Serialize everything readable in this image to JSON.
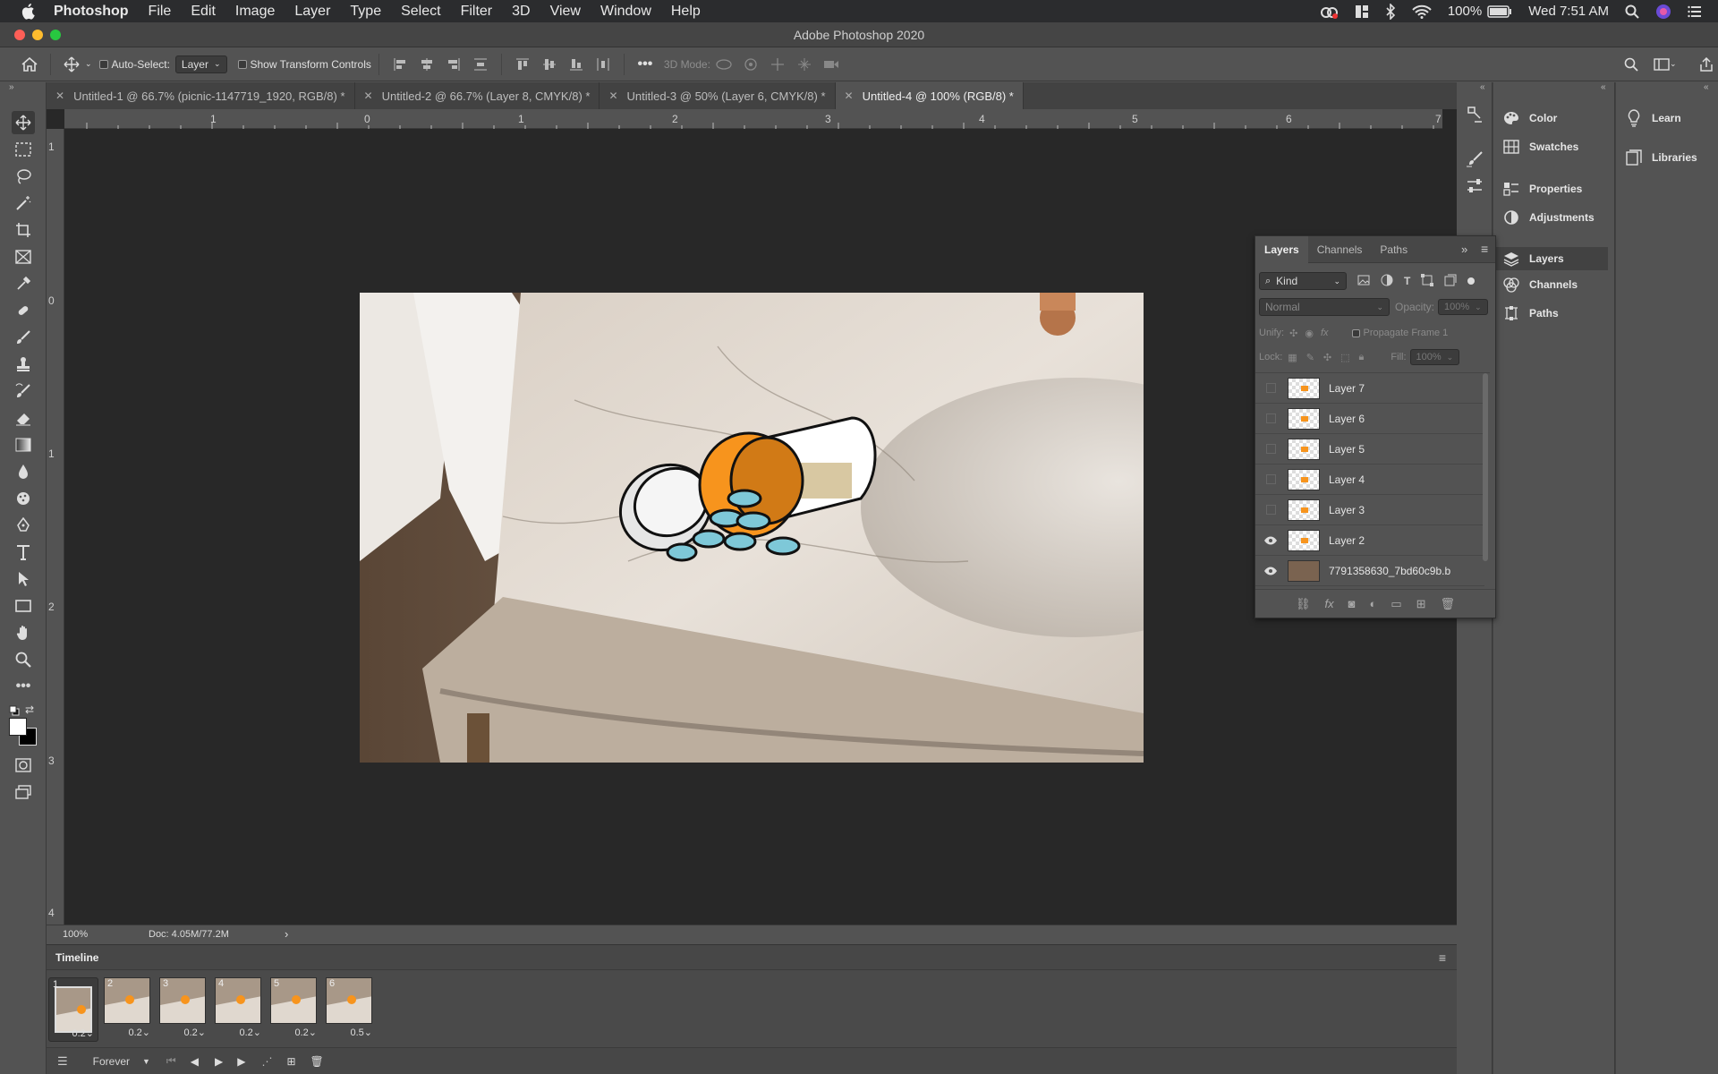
{
  "menubar": {
    "app": "Photoshop",
    "items": [
      "File",
      "Edit",
      "Image",
      "Layer",
      "Type",
      "Select",
      "Filter",
      "3D",
      "View",
      "Window",
      "Help"
    ],
    "battery": "100%",
    "clock": "Wed 7:51 AM"
  },
  "window": {
    "title": "Adobe Photoshop 2020"
  },
  "options": {
    "auto_select_label": "Auto-Select:",
    "auto_select_value": "Layer",
    "show_transform_label": "Show Transform Controls",
    "mode_3d_label": "3D Mode:"
  },
  "tabs": [
    {
      "label": "Untitled-1 @ 66.7% (picnic-1147719_1920, RGB/8) *"
    },
    {
      "label": "Untitled-2 @ 66.7% (Layer 8, CMYK/8) *"
    },
    {
      "label": "Untitled-3 @ 50% (Layer 6, CMYK/8) *"
    },
    {
      "label": "Untitled-4 @ 100% (RGB/8) *"
    }
  ],
  "ruler": {
    "h": [
      "1",
      "0",
      "1",
      "2",
      "3",
      "4",
      "5",
      "6",
      "7"
    ],
    "v": [
      "1",
      "0",
      "1",
      "2",
      "3",
      "4"
    ]
  },
  "status": {
    "zoom": "100%",
    "doc": "Doc: 4.05M/77.2M",
    "arrow": "›"
  },
  "timeline": {
    "title": "Timeline",
    "frames": [
      {
        "num": "1",
        "delay": "0.2"
      },
      {
        "num": "2",
        "delay": "0.2"
      },
      {
        "num": "3",
        "delay": "0.2"
      },
      {
        "num": "4",
        "delay": "0.2"
      },
      {
        "num": "5",
        "delay": "0.2"
      },
      {
        "num": "6",
        "delay": "0.5"
      }
    ],
    "loop": "Forever"
  },
  "dock": {
    "col1": [
      "Color",
      "Swatches",
      "Properties",
      "Adjustments",
      "Layers",
      "Channels",
      "Paths"
    ],
    "col2": [
      "Learn",
      "Libraries"
    ]
  },
  "layers_panel": {
    "tabs": [
      "Layers",
      "Channels",
      "Paths"
    ],
    "filter_kind": "Kind",
    "blend_mode": "Normal",
    "opacity_label": "Opacity:",
    "opacity_value": "100%",
    "unify_label": "Unify:",
    "propagate_label": "Propagate Frame 1",
    "lock_label": "Lock:",
    "fill_label": "Fill:",
    "fill_value": "100%",
    "layers": [
      {
        "name": "Layer 7",
        "visible": false
      },
      {
        "name": "Layer 6",
        "visible": false
      },
      {
        "name": "Layer 5",
        "visible": false
      },
      {
        "name": "Layer 4",
        "visible": false
      },
      {
        "name": "Layer 3",
        "visible": false
      },
      {
        "name": "Layer 2",
        "visible": true
      },
      {
        "name": "7791358630_7bd60c9b.b",
        "visible": true
      }
    ]
  },
  "colors": {
    "accent_orange": "#f7941d",
    "pill_blue": "#7ec8d8"
  }
}
